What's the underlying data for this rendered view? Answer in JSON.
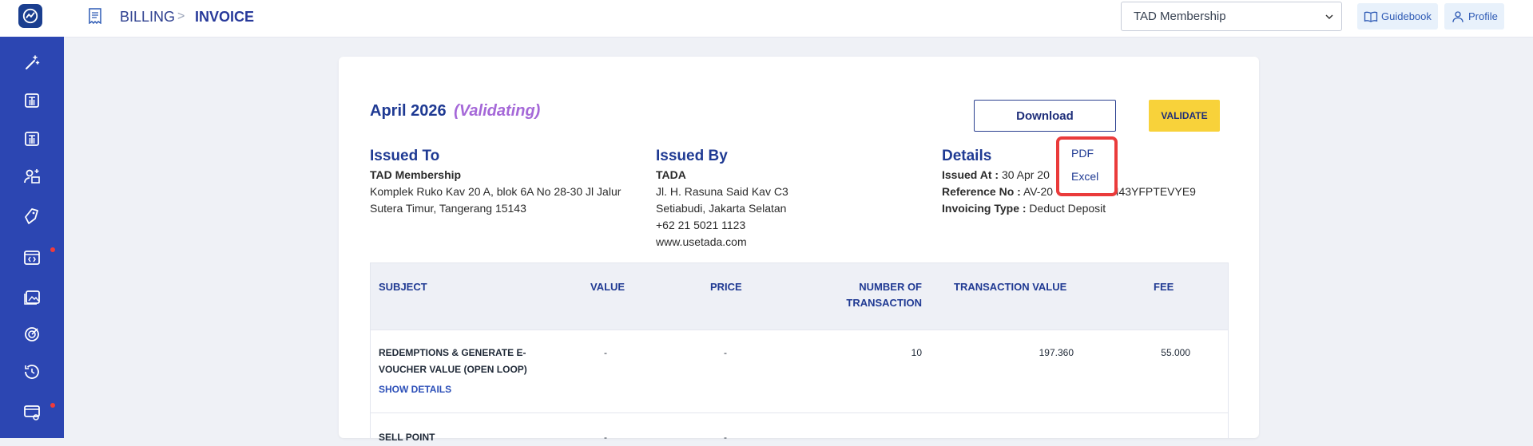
{
  "header": {
    "breadcrumb": [
      "BILLING",
      "INVOICE"
    ],
    "breadcrumb_sep": ">",
    "company_select": "TAD Membership",
    "guidebook": "Guidebook",
    "profile": "Profile"
  },
  "sidebar": {
    "items": [
      {
        "icon": "magic-wand-icon"
      },
      {
        "icon": "tada-t-icon"
      },
      {
        "icon": "tada-t-icon"
      },
      {
        "icon": "user-add-icon"
      },
      {
        "icon": "tag-icon"
      },
      {
        "icon": "code-window-icon",
        "badge": true
      },
      {
        "icon": "gallery-icon"
      },
      {
        "icon": "target-icon"
      },
      {
        "icon": "history-icon"
      },
      {
        "icon": "billing-settings-icon",
        "badge": true
      }
    ]
  },
  "invoice": {
    "period": "April 2026",
    "status": "(Validating)",
    "download": "Download",
    "validate": "VALIDATE",
    "download_menu": [
      "PDF",
      "Excel"
    ],
    "issued_to": {
      "heading": "Issued To",
      "name": "TAD Membership",
      "address1": "Komplek Ruko Kav 20 A, blok 6A No 28-30 Jl Jalur",
      "address2": "Sutera Timur, Tangerang 15143"
    },
    "issued_by": {
      "heading": "Issued By",
      "name": "TADA",
      "line1": "Jl. H. Rasuna Said Kav C3",
      "line2": "Setiabudi, Jakarta Selatan",
      "phone": "+62 21 5021 1123",
      "website": "www.usetada.com"
    },
    "details": {
      "heading": "Details",
      "issued_at_label": "Issued At :",
      "issued_at": "30 Apr 20",
      "reference_label": "Reference No :",
      "reference_start": "AV-20",
      "reference_end": "3LI43YFPTEVYE9",
      "invoicing_type_label": "Invoicing Type :",
      "invoicing_type": "Deduct Deposit"
    }
  },
  "table": {
    "headers": {
      "subject": "SUBJECT",
      "value": "VALUE",
      "price": "PRICE",
      "number_line1": "NUMBER OF",
      "number_line2": "TRANSACTION",
      "transaction_value": "TRANSACTION VALUE",
      "fee": "FEE"
    },
    "rows": [
      {
        "subject_line1": "REDEMPTIONS & GENERATE E-",
        "subject_line2": "VOUCHER VALUE (OPEN LOOP)",
        "value": "-",
        "price": "-",
        "number": "10",
        "transaction_value": "197.360",
        "fee": "55.000",
        "show_details": "SHOW DETAILS"
      },
      {
        "subject_line1": "SELL POINT",
        "value": "-",
        "price": "-"
      }
    ]
  }
}
